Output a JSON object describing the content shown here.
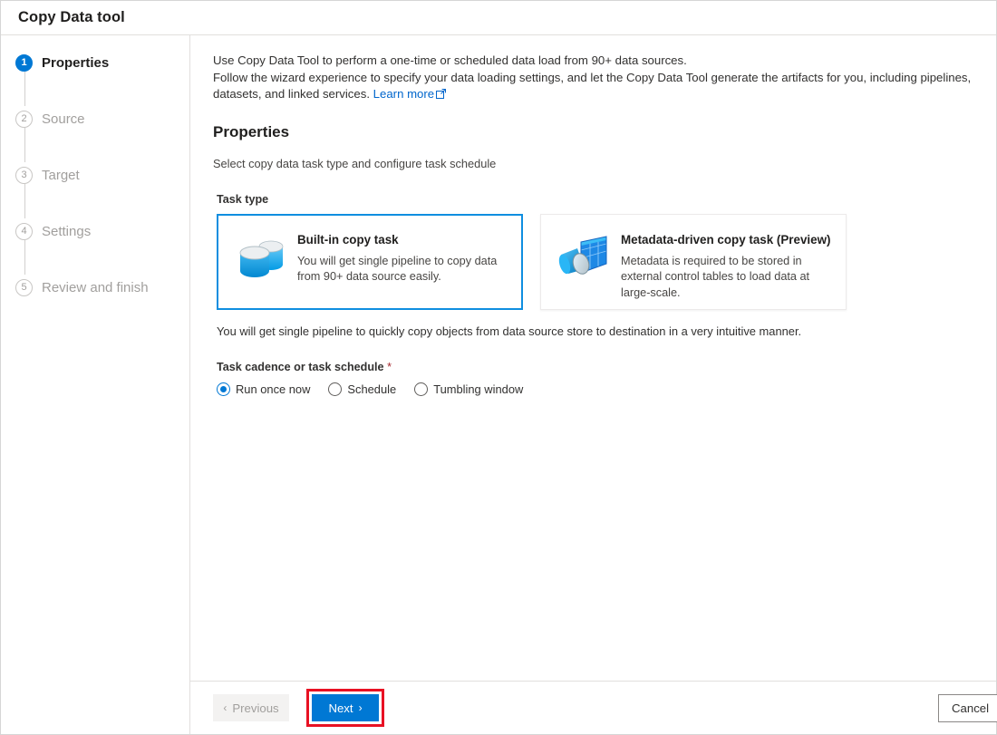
{
  "window": {
    "title": "Copy Data tool"
  },
  "sidebar": {
    "steps": [
      {
        "number": "1",
        "label": "Properties",
        "state": "active"
      },
      {
        "number": "2",
        "label": "Source",
        "state": "inactive"
      },
      {
        "number": "3",
        "label": "Target",
        "state": "inactive"
      },
      {
        "number": "4",
        "label": "Settings",
        "state": "inactive"
      },
      {
        "number": "5",
        "label": "Review and finish",
        "state": "inactive"
      }
    ]
  },
  "main": {
    "intro_line1": "Use Copy Data Tool to perform a one-time or scheduled data load from 90+ data sources.",
    "intro_line2": "Follow the wizard experience to specify your data loading settings, and let the Copy Data Tool generate the artifacts for you, including pipelines, datasets, and linked services.",
    "learn_more": "Learn more",
    "section_title": "Properties",
    "section_subtitle": "Select copy data task type and configure task schedule",
    "task_type_label": "Task type",
    "cards": [
      {
        "title": "Built-in copy task",
        "description": "You will get single pipeline to copy data from 90+ data source easily.",
        "icon": "database-copy-icon",
        "selected": true
      },
      {
        "title": "Metadata-driven copy task (Preview)",
        "description": "Metadata is required to be stored in external control tables to load data at large-scale.",
        "icon": "metadata-table-search-icon",
        "selected": false
      }
    ],
    "helper_text": "You will get single pipeline to quickly copy objects from data source store to destination in a very intuitive manner.",
    "cadence_label": "Task cadence or task schedule",
    "required_marker": "*",
    "cadence_options": [
      {
        "label": "Run once now",
        "checked": true
      },
      {
        "label": "Schedule",
        "checked": false
      },
      {
        "label": "Tumbling window",
        "checked": false
      }
    ]
  },
  "footer": {
    "previous_label": "Previous",
    "next_label": "Next",
    "cancel_label": "Cancel",
    "previous_chevron": "‹",
    "next_chevron": "›"
  },
  "colors": {
    "accent": "#0078d4",
    "link": "#0066cc",
    "highlight": "#e81123",
    "selected_border": "#0f8ee0",
    "required": "#a4262c"
  }
}
